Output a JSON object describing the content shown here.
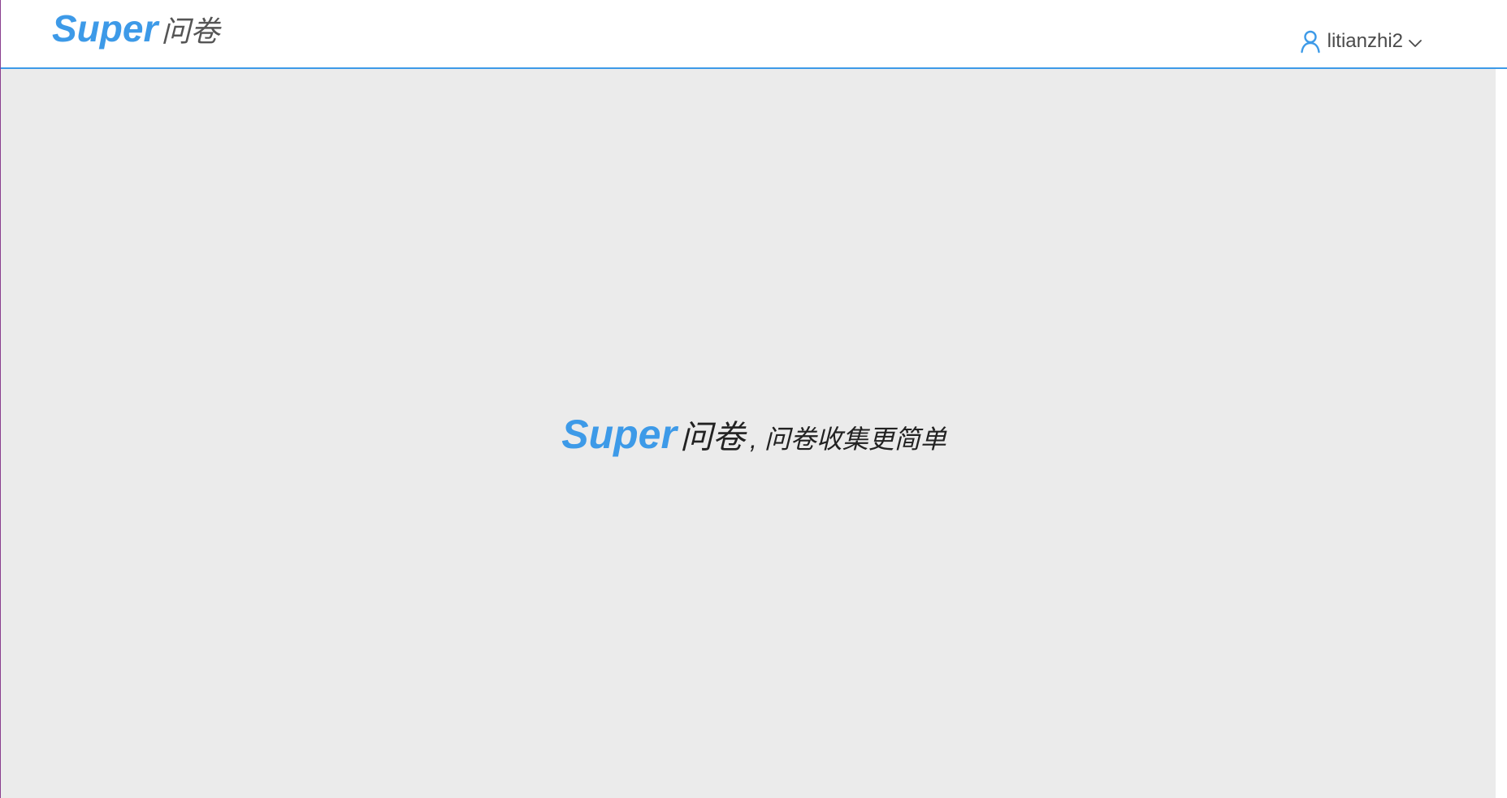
{
  "header": {
    "logo": {
      "brand": "Super",
      "product": "问卷"
    },
    "user_menu": {
      "icon": "user-icon",
      "username": "litianzhi2",
      "dropdown_icon": "chevron-down-icon"
    }
  },
  "main": {
    "hero": {
      "brand": "Super",
      "product": "问卷",
      "tagline": ", 问卷收集更简单"
    }
  },
  "colors": {
    "brand_blue": "#3d9ae8",
    "header_border": "#3d9ae8",
    "main_background": "#ebebeb",
    "text_dark": "#222222",
    "text_muted": "#555555"
  }
}
